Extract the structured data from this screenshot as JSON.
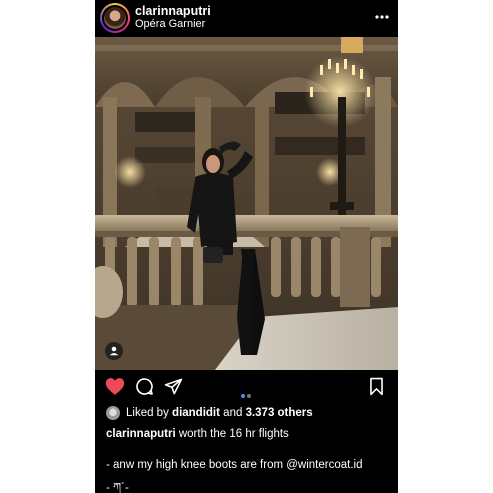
{
  "post": {
    "username": "clarinnaputri",
    "location": "Opéra Garnier",
    "more_icon": "more-horizontal-icon",
    "likes": {
      "prefix": "Liked by",
      "liked_by_user": "diandidit",
      "and": "and",
      "others": "3.373 others"
    },
    "caption": {
      "username": "clarinnaputri",
      "text": "worth the 16 hr flights",
      "line2": "- anw my high knee boots are from @wintercoat.id",
      "line3": "- ཀ´-"
    },
    "carousel": {
      "count": 2,
      "active_index": 0
    },
    "icons": {
      "like": "heart-filled-icon",
      "comment": "comment-icon",
      "share": "share-icon",
      "save": "bookmark-icon",
      "tag": "user-tag-icon"
    },
    "colors": {
      "like": "#ed4956",
      "carousel_active": "#3897f0",
      "carousel_inactive": "#737373",
      "background": "#000000",
      "text": "#ffffff"
    }
  }
}
